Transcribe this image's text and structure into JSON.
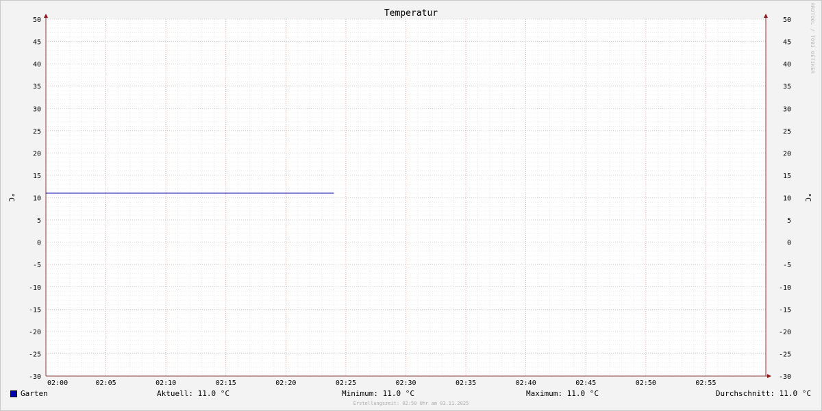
{
  "chart_data": {
    "type": "line",
    "title": "Temperatur",
    "ylabel": "°C",
    "ylabel_right": "°C",
    "ylim": [
      -30,
      50
    ],
    "yticks": [
      50,
      45,
      40,
      35,
      30,
      25,
      20,
      15,
      10,
      5,
      0,
      -5,
      -10,
      -15,
      -20,
      -25,
      -30
    ],
    "xlim": [
      "02:00",
      "02:59"
    ],
    "xticks": [
      "02:00",
      "02:05",
      "02:10",
      "02:15",
      "02:20",
      "02:25",
      "02:30",
      "02:35",
      "02:40",
      "02:45",
      "02:50",
      "02:55"
    ],
    "grid": true,
    "series": [
      {
        "name": "Garten",
        "color": "#0000aa",
        "x": [
          "02:00",
          "02:24"
        ],
        "values": [
          11.0,
          11.0
        ]
      }
    ]
  },
  "legend": {
    "series_name": "Garten",
    "current": "Aktuell: 11.0 °C",
    "minimum": "Minimum: 11.0 °C",
    "maximum": "Maximum: 11.0 °C",
    "average": "Durchschnitt: 11.0 °C"
  },
  "footer": {
    "created": "Erstellungszeit: 02:50 Uhr am 03.11.2025"
  },
  "watermark": "RRDTOOL / TOBI OETIKER"
}
